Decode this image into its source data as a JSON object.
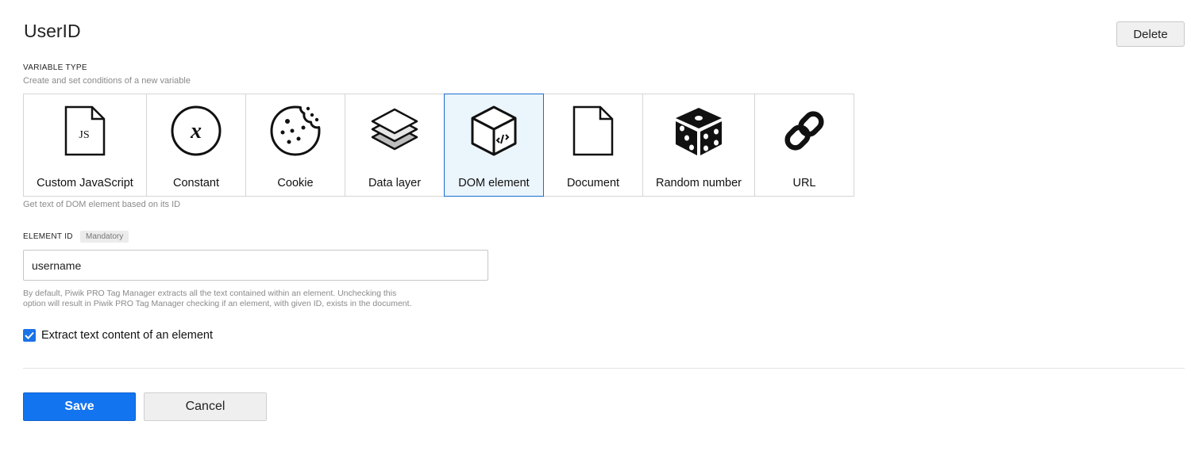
{
  "header": {
    "title": "UserID",
    "delete_label": "Delete"
  },
  "variable_type": {
    "label": "VARIABLE TYPE",
    "hint": "Create and set conditions of a new variable",
    "selected_hint": "Get text of DOM element based on its ID",
    "selected": "DOM element",
    "items": [
      {
        "label": "Custom JavaScript",
        "icon": "custom-javascript-icon",
        "icon_text": "JS"
      },
      {
        "label": "Constant",
        "icon": "constant-icon",
        "icon_text": "x"
      },
      {
        "label": "Cookie",
        "icon": "cookie-icon"
      },
      {
        "label": "Data layer",
        "icon": "data-layer-icon"
      },
      {
        "label": "DOM element",
        "icon": "dom-element-icon"
      },
      {
        "label": "Document",
        "icon": "document-icon"
      },
      {
        "label": "Random number",
        "icon": "dice-icon"
      },
      {
        "label": "URL",
        "icon": "link-icon"
      }
    ]
  },
  "element_id": {
    "label": "ELEMENT ID",
    "badge": "Mandatory",
    "value": "username",
    "description": "By default, Piwik PRO Tag Manager extracts all the text contained within an element. Unchecking this option will result in Piwik PRO Tag Manager checking if an element, with given ID, exists in the document."
  },
  "extract_option": {
    "label": "Extract text content of an element",
    "checked": true
  },
  "actions": {
    "save_label": "Save",
    "cancel_label": "Cancel"
  },
  "colors": {
    "primary": "#1374f0",
    "selected_border": "#1a6fce",
    "selected_bg": "#ebf5fc"
  }
}
